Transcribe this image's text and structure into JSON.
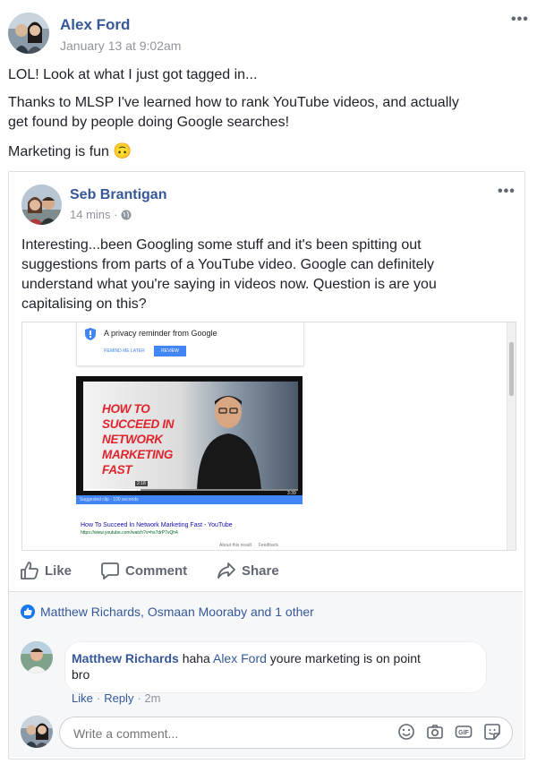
{
  "post": {
    "author": "Alex Ford",
    "timestamp": "January 13 at 9:02am",
    "options_label": "•••",
    "lines": [
      "LOL! Look at what I just got tagged in...",
      "Thanks to MLSP I've learned how to rank YouTube videos, and actually",
      "get found by people doing Google searches!"
    ],
    "marketing_line": "Marketing is fun",
    "emoji": "🙃"
  },
  "shared": {
    "author": "Seb Brantigan",
    "time": "14 mins ·",
    "options_label": "•••",
    "lines": [
      "Interesting...been Googling some stuff and it's been spitting out",
      "suggestions from parts of a YouTube video. Google can definitely",
      "understand what you're saying in videos now. Question is are you",
      "capitalising on this?"
    ],
    "screenshot": {
      "privacy_title": "A privacy reminder from Google",
      "remind_later": "REMIND ME LATER",
      "review": "REVIEW",
      "video_title_lines": [
        "HOW TO",
        "SUCCEED IN",
        "NETWORK",
        "MARKETING",
        "FAST"
      ],
      "time_start": "2:18",
      "time_end": "3:39",
      "suggested_clip": "Suggested clip · 100 seconds",
      "result_title": "How To Succeed In Network Marketing Fast - YouTube",
      "result_url": "https://www.youtube.com/watch?v=hs7drP7vQh4",
      "about_result": "About this result",
      "feedback": "Feedback"
    }
  },
  "actions": {
    "like": "Like",
    "comment": "Comment",
    "share": "Share"
  },
  "reactions": {
    "text": "Matthew Richards, Osmaan Mooraby and 1 other"
  },
  "comment": {
    "author": "Matthew Richards",
    "text_before": "haha",
    "mention": "Alex Ford",
    "text_after_line1": "youre marketing is on point",
    "text_after_line2": "bro",
    "like": "Like",
    "dot": "·",
    "reply": "Reply",
    "time": "· 2m"
  },
  "input": {
    "placeholder": "Write a comment..."
  },
  "colors": {
    "link": "#365899",
    "like_badge": "#1877f2",
    "meta": "#90949c"
  }
}
